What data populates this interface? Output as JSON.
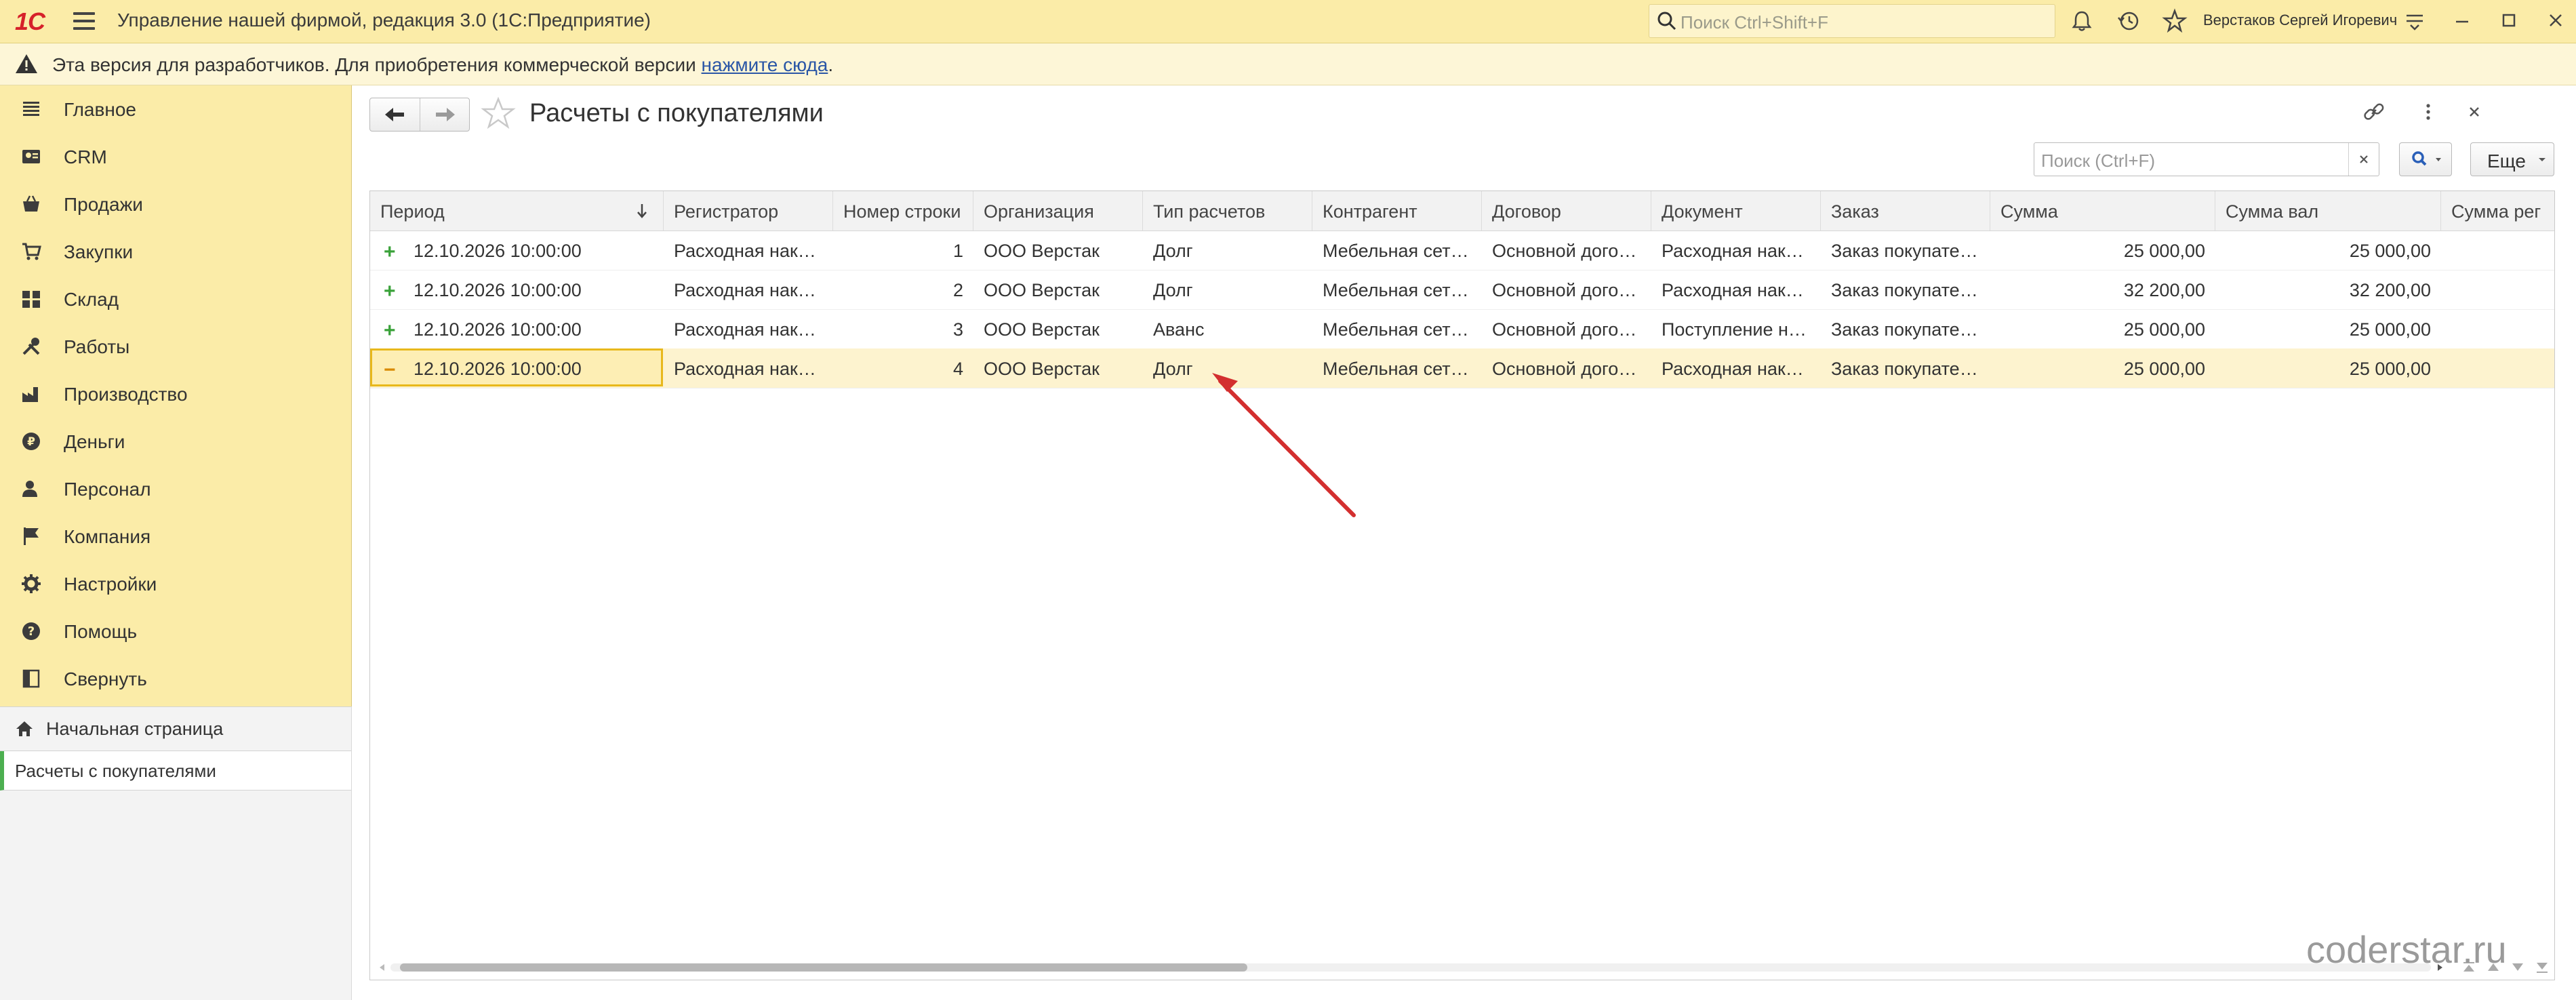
{
  "titlebar": {
    "logo": "1С",
    "app_title": "Управление нашей фирмой, редакция 3.0  (1С:Предприятие)",
    "search_placeholder": "Поиск Ctrl+Shift+F",
    "user": "Верстаков Сергей Игоревич"
  },
  "banner": {
    "text": "Эта версия для разработчиков. Для приобретения коммерческой версии ",
    "link": "нажмите сюда",
    "tail": "."
  },
  "sidebar": {
    "items": [
      {
        "label": "Главное",
        "icon": "list-icon"
      },
      {
        "label": "CRM",
        "icon": "crm-icon"
      },
      {
        "label": "Продажи",
        "icon": "basket-icon"
      },
      {
        "label": "Закупки",
        "icon": "cart-icon"
      },
      {
        "label": "Склад",
        "icon": "warehouse-icon"
      },
      {
        "label": "Работы",
        "icon": "tools-icon"
      },
      {
        "label": "Производство",
        "icon": "factory-icon"
      },
      {
        "label": "Деньги",
        "icon": "ruble-icon"
      },
      {
        "label": "Персонал",
        "icon": "person-icon"
      },
      {
        "label": "Компания",
        "icon": "flag-icon"
      },
      {
        "label": "Настройки",
        "icon": "gear-icon"
      },
      {
        "label": "Помощь",
        "icon": "help-icon"
      },
      {
        "label": "Свернуть",
        "icon": "collapse-icon"
      }
    ],
    "home": "Начальная страница",
    "current": "Расчеты с покупателями"
  },
  "content": {
    "title": "Расчеты с покупателями",
    "search_placeholder": "Поиск (Ctrl+F)",
    "more": "Еще"
  },
  "table": {
    "columns": [
      "Период",
      "Регистратор",
      "Номер строки",
      "Организация",
      "Тип расчетов",
      "Контрагент",
      "Договор",
      "Документ",
      "Заказ",
      "Сумма",
      "Сумма вал",
      "Сумма рег"
    ],
    "rows": [
      {
        "mark": "+",
        "period": "12.10.2026 10:00:00",
        "registrar": "Расходная нак…",
        "line": "1",
        "org": "ООО Верстак",
        "type": "Долг",
        "counterparty": "Мебельная сет…",
        "contract": "Основной дого…",
        "document": "Расходная нак…",
        "order": "Заказ покупате…",
        "sum": "25 000,00",
        "sum_cur": "25 000,00",
        "sum_reg": ""
      },
      {
        "mark": "+",
        "period": "12.10.2026 10:00:00",
        "registrar": "Расходная нак…",
        "line": "2",
        "org": "ООО Верстак",
        "type": "Долг",
        "counterparty": "Мебельная сет…",
        "contract": "Основной дого…",
        "document": "Расходная нак…",
        "order": "Заказ покупате…",
        "sum": "32 200,00",
        "sum_cur": "32 200,00",
        "sum_reg": ""
      },
      {
        "mark": "+",
        "period": "12.10.2026 10:00:00",
        "registrar": "Расходная нак…",
        "line": "3",
        "org": "ООО Верстак",
        "type": "Аванс",
        "counterparty": "Мебельная сет…",
        "contract": "Основной дого…",
        "document": "Поступление н…",
        "order": "Заказ покупате…",
        "sum": "25 000,00",
        "sum_cur": "25 000,00",
        "sum_reg": ""
      },
      {
        "mark": "−",
        "period": "12.10.2026 10:00:00",
        "registrar": "Расходная нак…",
        "line": "4",
        "org": "ООО Верстак",
        "type": "Долг",
        "counterparty": "Мебельная сет…",
        "contract": "Основной дого…",
        "document": "Расходная нак…",
        "order": "Заказ покупате…",
        "sum": "25 000,00",
        "sum_cur": "25 000,00",
        "sum_reg": ""
      }
    ]
  },
  "watermark": "coderstar.ru",
  "colors": {
    "header_bg": "#fbeca8",
    "banner_bg": "#fdf6d7",
    "selected_row": "#fdf3cf",
    "focus_border": "#e8b81c",
    "arrow": "#d32f2f",
    "plus": "#3aa23a",
    "minus": "#d98a00"
  }
}
